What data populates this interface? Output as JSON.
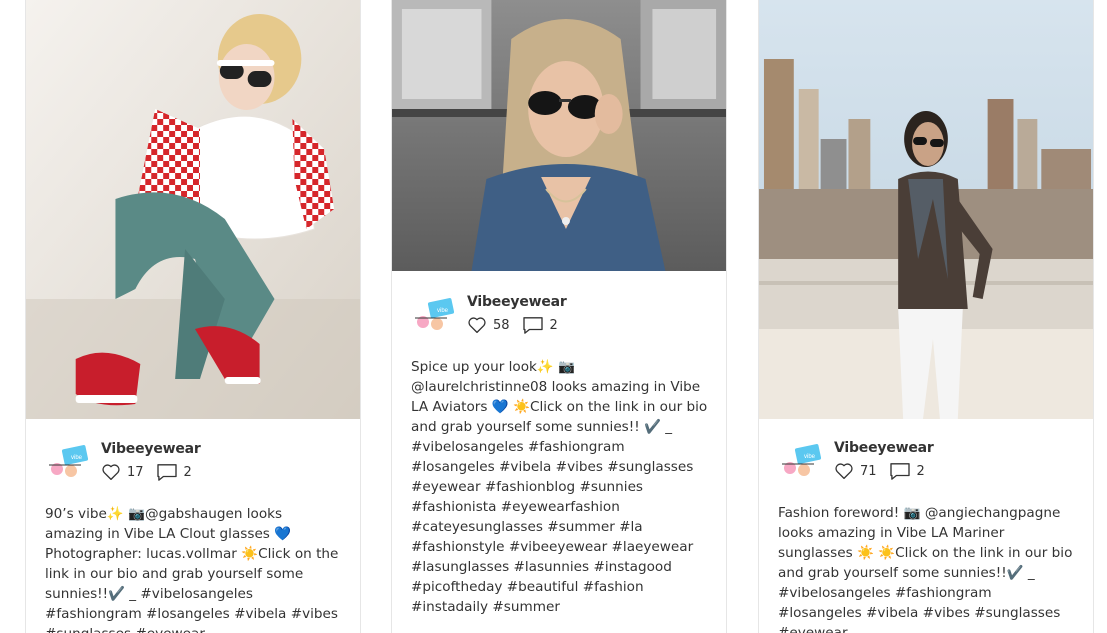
{
  "feed": {
    "posts": [
      {
        "author": "Vibeeyewear",
        "likes": "17",
        "comments": "2",
        "caption": "90’s vibe✨ 📷@gabshaugen looks amazing in Vibe LA Clout glasses 💙 Photographer: lucas.vollmar ☀️Click on the link in our bio and grab yourself some sunnies!!✔️ _ #vibelosangeles #fashiongram #losangeles #vibela #vibes #sunglasses #eyewear"
      },
      {
        "author": "Vibeeyewear",
        "likes": "58",
        "comments": "2",
        "caption": "Spice up your look✨ 📷 @laurelchristinne08 looks amazing in Vibe LA Aviators 💙 ☀️Click on the link in our bio and grab yourself some sunnies!! ✔️ _ #vibelosangeles #fashiongram #losangeles #vibela #vibes #sunglasses #eyewear #fashionblog #sunnies #fashionista #eyewearfashion #cateyesunglasses #summer #la #fashionstyle #vibeeyewear #laeyewear #lasunglasses #lasunnies #instagood #picoftheday #beautiful #fashion #instadaily #summer"
      },
      {
        "author": "Vibeeyewear",
        "likes": "71",
        "comments": "2",
        "caption": "Fashion foreword! 📷 @angiechangpagne looks amazing in Vibe LA Mariner sunglasses ☀️ ☀️Click on the link in our bio and grab yourself some sunnies!!✔️ _ #vibelosangeles #fashiongram #losangeles #vibela #vibes #sunglasses #eyewear"
      }
    ]
  },
  "icons": {
    "like": "heart-icon",
    "comment": "comment-icon",
    "avatar": "vibe-logo-avatar"
  },
  "colors": {
    "text": "#333333",
    "card_border": "#e6e6e6",
    "avatar_accent": "#5bc8f0",
    "avatar_pink": "#f7a8c4"
  }
}
